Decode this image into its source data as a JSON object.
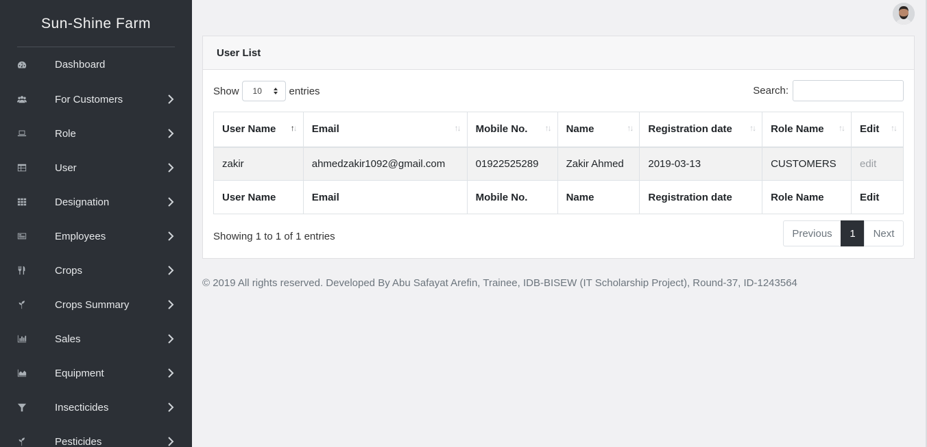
{
  "sidebar": {
    "brand": "Sun-Shine Farm",
    "items": [
      {
        "label": "Dashboard",
        "icon": "dashboard-icon",
        "has_children": false
      },
      {
        "label": "For Customers",
        "icon": "users-icon",
        "has_children": true
      },
      {
        "label": "Role",
        "icon": "laptop-icon",
        "has_children": true
      },
      {
        "label": "User",
        "icon": "table-icon",
        "has_children": true
      },
      {
        "label": "Designation",
        "icon": "grid-icon",
        "has_children": true
      },
      {
        "label": "Employees",
        "icon": "id-card-icon",
        "has_children": true
      },
      {
        "label": "Crops",
        "icon": "utensils-icon",
        "has_children": true
      },
      {
        "label": "Crops Summary",
        "icon": "seedling-icon",
        "has_children": true
      },
      {
        "label": "Sales",
        "icon": "bar-chart-icon",
        "has_children": true
      },
      {
        "label": "Equipment",
        "icon": "area-chart-icon",
        "has_children": true
      },
      {
        "label": "Insecticides",
        "icon": "funnel-icon",
        "has_children": true
      },
      {
        "label": "Pesticides",
        "icon": "seedling-icon",
        "has_children": true
      }
    ]
  },
  "card": {
    "title": "User List",
    "show_label": "Show",
    "entries_value": "10",
    "entries_label": "entries",
    "search_label": "Search:",
    "search_value": ""
  },
  "table": {
    "headers": [
      "User Name",
      "Email",
      "Mobile No.",
      "Name",
      "Registration date",
      "Role Name",
      "Edit"
    ],
    "rows": [
      {
        "user_name": "zakir",
        "email": "ahmedzakir1092@gmail.com",
        "mobile": "01922525289",
        "name": "Zakir Ahmed",
        "reg_date": "2019-03-13",
        "role": "CUSTOMERS",
        "edit": "edit"
      }
    ],
    "sorted_column": "User Name"
  },
  "info": "Showing 1 to 1 of 1 entries",
  "pagination": {
    "previous": "Previous",
    "current": "1",
    "next": "Next"
  },
  "footer": "© 2019 All rights reserved. Developed By Abu Safayat Arefin, Trainee, IDB-BISEW (IT Scholarship Project), Round-37, ID-1243564",
  "colors": {
    "sidebar_bg": "#2c3036",
    "content_bg": "#f1f1f3",
    "active_page": "#2c3036"
  }
}
